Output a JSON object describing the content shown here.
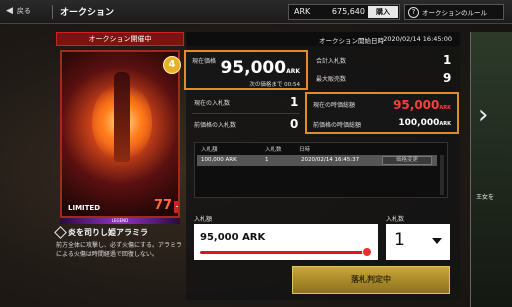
{
  "header": {
    "back_label": "戻る",
    "title": "オークション",
    "currency_label": "ARK",
    "currency_value": "675,640",
    "buy_label": "購入",
    "rules_label": "オークションのルール"
  },
  "card": {
    "ribbon": "オークション開催中",
    "limited": "LIMITED",
    "number": "77",
    "rarity": "LEGEND",
    "name": "炎を司りし姫アラミラ",
    "description": "前方全体に攻撃し、必ず火傷にする。アラミラによる火傷は時間経過で回復しない。",
    "badge": "4"
  },
  "auction": {
    "start_label": "オークション開始日時",
    "start_value": "2020/02/14 16:45:00",
    "current_price_label": "現在価格",
    "current_price_value": "95,000",
    "current_price_unit": "ARK",
    "next_update": "次の価格まで 00:54",
    "total_bids_label": "合計入札数",
    "total_bids_value": "1",
    "max_sales_label": "最大販売数",
    "max_sales_value": "9",
    "current_bids_label": "現在の入札数",
    "current_bids_value": "1",
    "prev_bids_label": "前価格の入札数",
    "prev_bids_value": "0",
    "market_total_label": "現在の時価総額",
    "market_total_value": "95,000",
    "market_total_unit": "ARK",
    "prev_market_label": "前価格の時価総額",
    "prev_market_value": "100,000",
    "prev_market_unit": "ARK"
  },
  "bid_table": {
    "headers": [
      "入札額",
      "入札数",
      "日時"
    ],
    "rows": [
      {
        "amount": "100,000 ARK",
        "count": "1",
        "datetime": "2020/02/14 16:45:37",
        "action": "価格変更"
      }
    ]
  },
  "bid_form": {
    "amount_label": "入札額",
    "amount_value": "95,000 ARK",
    "qty_label": "入札数",
    "qty_value": "1",
    "status_button": "落札判定中"
  },
  "peek": {
    "text": "王女を"
  }
}
